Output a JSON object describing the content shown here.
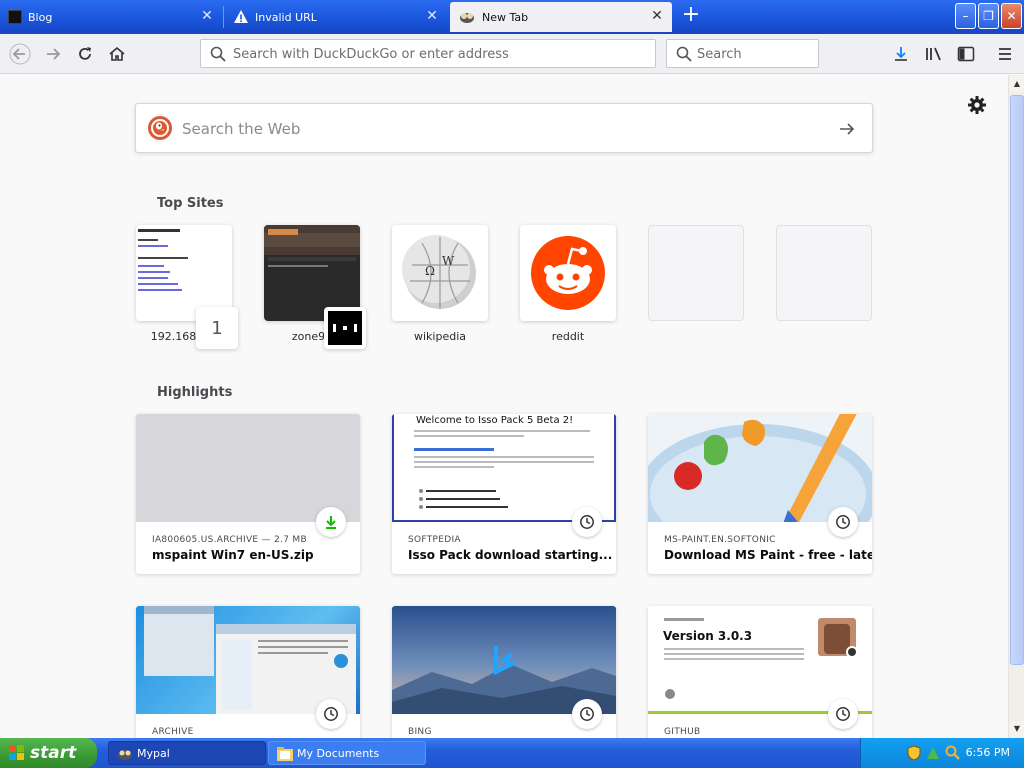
{
  "tabs": [
    {
      "label": "Blog"
    },
    {
      "label": "Invalid URL"
    },
    {
      "label": "New Tab"
    }
  ],
  "toolbar": {
    "url_placeholder": "Search with DuckDuckGo or enter address",
    "search_placeholder": "Search"
  },
  "newtab": {
    "web_search_placeholder": "Search the Web",
    "top_sites_title": "Top Sites",
    "top_sites": [
      {
        "label": "192.168.1.1",
        "badge": "1"
      },
      {
        "label": "zone94"
      },
      {
        "label": "wikipedia"
      },
      {
        "label": "reddit"
      },
      {
        "label": ""
      },
      {
        "label": ""
      }
    ],
    "highlights_title": "Highlights",
    "highlights": [
      {
        "source": "IA800605.US.ARCHIVE — 2.7 MB",
        "title": "mspaint Win7 en-US.zip",
        "icon": "download-icon"
      },
      {
        "source": "SOFTPEDIA",
        "title": "Isso Pack download starting...",
        "icon": "clock-icon",
        "preview_heading": "Welcome to Isso Pack 5 Beta 2!"
      },
      {
        "source": "MS-PAINT.EN.SOFTONIC",
        "title": "Download MS Paint - free - lates...",
        "icon": "clock-icon"
      },
      {
        "source": "ARCHIVE",
        "title": "",
        "icon": "clock-icon"
      },
      {
        "source": "BING",
        "title": "",
        "icon": "clock-icon"
      },
      {
        "source": "GITHUB",
        "title": "",
        "icon": "clock-icon",
        "preview_heading": "Version 3.0.3"
      }
    ]
  },
  "taskbar": {
    "start_label": "start",
    "tasks": [
      {
        "label": "Mypal"
      },
      {
        "label": "My Documents"
      }
    ],
    "clock": "6:56 PM"
  },
  "colors": {
    "tabbar_blue": "#1a54d8",
    "taskbar_blue": "#245edb",
    "start_green": "#3a9a34",
    "duckduckgo_orange": "#de5833",
    "reddit_orange": "#ff4500",
    "download_green": "#12bc00"
  }
}
